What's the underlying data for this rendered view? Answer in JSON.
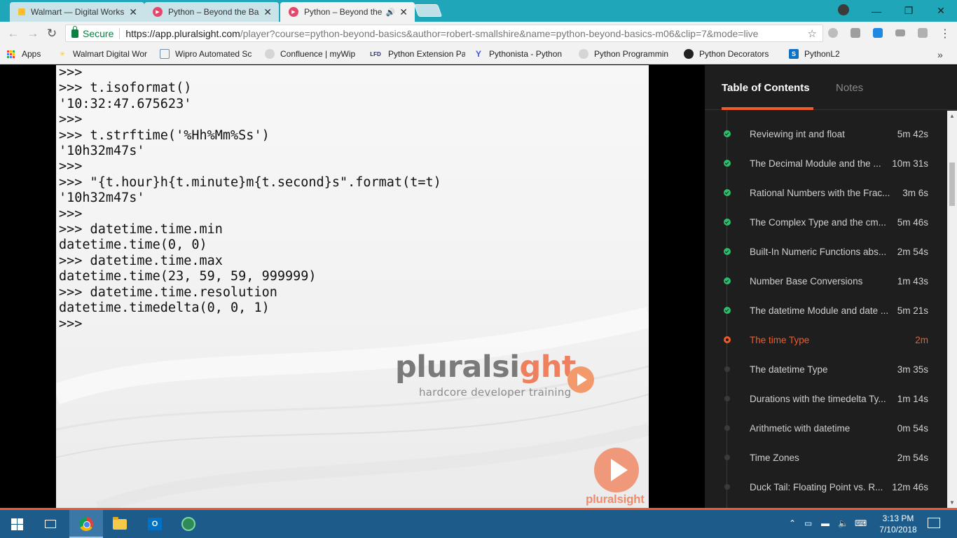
{
  "browser": {
    "tabs": [
      {
        "title": "Walmart — Digital Works",
        "favicon": "walmart-icon",
        "state": "inactive"
      },
      {
        "title": "Python – Beyond the Basics",
        "favicon": "pluralsight-icon",
        "state": "inactive"
      },
      {
        "title": "Python – Beyond the Basics",
        "favicon": "pluralsight-icon",
        "state": "active",
        "audio": true
      }
    ],
    "address": {
      "secure_label": "Secure",
      "url_host": "https://app.pluralsight.com",
      "url_path": "/player?course=python-beyond-basics&author=robert-smallshire&name=python-beyond-basics-m06&clip=7&mode=live"
    },
    "bookmarks": [
      {
        "label": "Apps",
        "icon": "apps-grid-icon"
      },
      {
        "label": "Walmart Digital Wor",
        "icon": "walmart-icon"
      },
      {
        "label": "Wipro Automated Sc",
        "icon": "document-icon"
      },
      {
        "label": "Confluence | myWip",
        "icon": "confluence-icon"
      },
      {
        "label": "Python Extension Pa",
        "icon": "lfd-icon"
      },
      {
        "label": "Pythonista - Python",
        "icon": "yc-icon"
      },
      {
        "label": "Python Programmin",
        "icon": "python-programming-icon"
      },
      {
        "label": "Python Decorators",
        "icon": "github-icon"
      },
      {
        "label": "PythonL2",
        "icon": "sharepoint-icon"
      }
    ]
  },
  "video": {
    "console_lines": [
      ">>>",
      ">>> t.isoformat()",
      "'10:32:47.675623'",
      ">>>",
      ">>> t.strftime('%Hh%Mm%Ss')",
      "'10h32m47s'",
      ">>>",
      ">>> \"{t.hour}h{t.minute}m{t.second}s\".format(t=t)",
      "'10h32m47s'",
      ">>>",
      ">>> datetime.time.min",
      "datetime.time(0, 0)",
      ">>> datetime.time.max",
      "datetime.time(23, 59, 59, 999999)",
      ">>> datetime.time.resolution",
      "datetime.timedelta(0, 0, 1)",
      ">>>"
    ],
    "logo_word_main": "pluralsi",
    "logo_word_tail": "ght",
    "logo_tagline": "hardcore developer training",
    "watermark": "pluralsight"
  },
  "sidebar": {
    "tab_toc": "Table of Contents",
    "tab_notes": "Notes",
    "clips": [
      {
        "title": "Reviewing int and float",
        "duration": "5m 42s",
        "status": "done"
      },
      {
        "title": "The Decimal Module and the ...",
        "duration": "10m 31s",
        "status": "done"
      },
      {
        "title": "Rational Numbers with the Frac...",
        "duration": "3m 6s",
        "status": "done"
      },
      {
        "title": "The Complex Type and the cm...",
        "duration": "5m 46s",
        "status": "done"
      },
      {
        "title": "Built-In Numeric Functions abs...",
        "duration": "2m 54s",
        "status": "done"
      },
      {
        "title": "Number Base Conversions",
        "duration": "1m 43s",
        "status": "done"
      },
      {
        "title": "The datetime Module and date ...",
        "duration": "5m 21s",
        "status": "done"
      },
      {
        "title": "The time Type",
        "duration": "2m",
        "status": "current"
      },
      {
        "title": "The datetime Type",
        "duration": "3m 35s",
        "status": "todo"
      },
      {
        "title": "Durations with the timedelta Ty...",
        "duration": "1m 14s",
        "status": "todo"
      },
      {
        "title": "Arithmetic with datetime",
        "duration": "0m 54s",
        "status": "todo"
      },
      {
        "title": "Time Zones",
        "duration": "2m 54s",
        "status": "todo"
      },
      {
        "title": "Duck Tail: Floating Point vs. R...",
        "duration": "12m 46s",
        "status": "todo"
      }
    ]
  },
  "taskbar": {
    "time": "3:13 PM",
    "date": "7/10/2018",
    "apps": [
      "windows-start-icon",
      "task-view-icon",
      "chrome-icon",
      "file-explorer-icon",
      "outlook-icon",
      "remote-desktop-icon"
    ]
  },
  "colors": {
    "accent": "#f15b2a",
    "tabstrip": "#1fa6b9",
    "taskbar": "#1c5b8a",
    "done": "#2bbf6c"
  }
}
